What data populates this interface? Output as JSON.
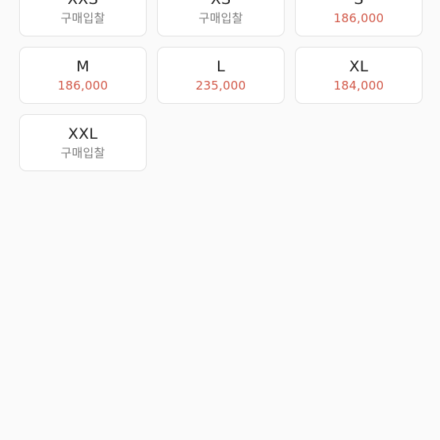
{
  "accent": "#d25a4a",
  "sizes": [
    {
      "size": "XXS",
      "price": "구매입찰",
      "kind": "bid"
    },
    {
      "size": "XS",
      "price": "구매입찰",
      "kind": "bid"
    },
    {
      "size": "S",
      "price": "186,000",
      "kind": "price"
    },
    {
      "size": "M",
      "price": "186,000",
      "kind": "price"
    },
    {
      "size": "L",
      "price": "235,000",
      "kind": "price"
    },
    {
      "size": "XL",
      "price": "184,000",
      "kind": "price"
    },
    {
      "size": "XXL",
      "price": "구매입찰",
      "kind": "bid"
    }
  ]
}
